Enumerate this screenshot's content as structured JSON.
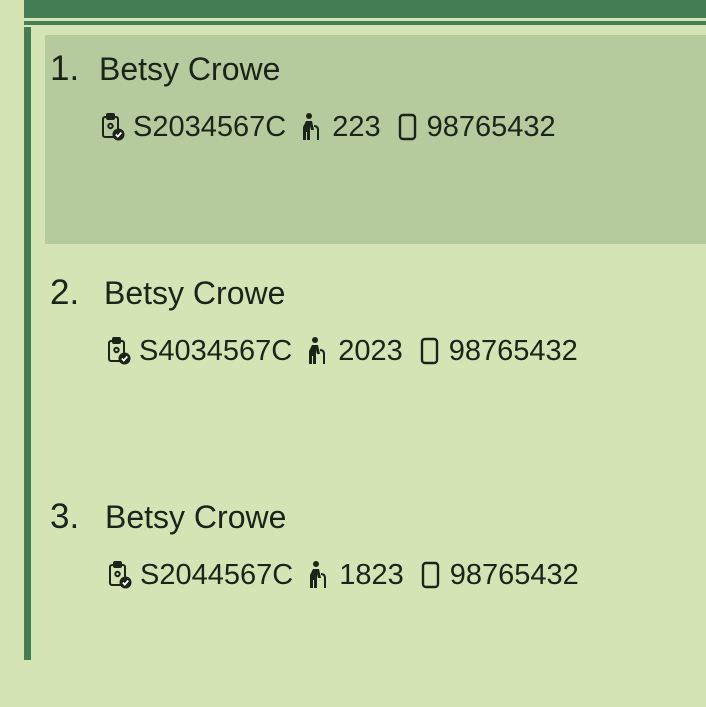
{
  "persons": [
    {
      "index": "1.",
      "name": "Betsy Crowe",
      "nric": "S2034567C",
      "age": "223",
      "phone": "98765432",
      "selected": true
    },
    {
      "index": "2.",
      "name": "Betsy Crowe",
      "nric": "S4034567C",
      "age": "2023",
      "phone": "98765432",
      "selected": false
    },
    {
      "index": "3.",
      "name": "Betsy Crowe",
      "nric": "S2044567C",
      "age": "1823",
      "phone": "98765432",
      "selected": false
    }
  ],
  "icons": {
    "id": "clipboard-check-icon",
    "age": "elderly-person-icon",
    "phone": "mobile-phone-icon"
  },
  "colors": {
    "background": "#d5e4b4",
    "accent": "#447c54",
    "selected": "#b5ca9d",
    "text": "#1a2418"
  }
}
